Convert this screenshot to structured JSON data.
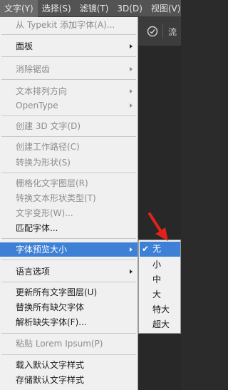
{
  "menubar": {
    "items": [
      "文字(Y)",
      "选择(S)",
      "滤镜(T)",
      "3D(D)",
      "视图(V)"
    ]
  },
  "toolbar": {
    "flow_text": "流"
  },
  "menu": {
    "items": [
      {
        "label": "从 Typekit 添加字体(A)...",
        "disabled": true
      },
      {
        "label": "面板",
        "disabled": false,
        "submenu": true
      },
      {
        "label": "消除锯齿",
        "disabled": true,
        "submenu": true
      },
      {
        "label": "文本排列方向",
        "disabled": true,
        "submenu": true
      },
      {
        "label": "OpenType",
        "disabled": true,
        "submenu": true
      },
      {
        "label": "创建 3D 文字(D)",
        "disabled": true
      },
      {
        "label": "创建工作路径(C)",
        "disabled": true
      },
      {
        "label": "转换为形状(S)",
        "disabled": true
      },
      {
        "label": "栅格化文字图层(R)",
        "disabled": true
      },
      {
        "label": "转换文本形状类型(T)",
        "disabled": true
      },
      {
        "label": "文字变形(W)...",
        "disabled": true
      },
      {
        "label": "匹配字体...",
        "disabled": false
      },
      {
        "label": "字体预览大小",
        "disabled": false,
        "submenu": true,
        "highlighted": true
      },
      {
        "label": "语言选项",
        "disabled": false,
        "submenu": true
      },
      {
        "label": "更新所有文字图层(U)",
        "disabled": false
      },
      {
        "label": "替换所有缺欠字体",
        "disabled": false
      },
      {
        "label": "解析缺失字体(F)...",
        "disabled": false
      },
      {
        "label": "粘贴 Lorem Ipsum(P)",
        "disabled": true
      },
      {
        "label": "载入默认文字样式",
        "disabled": false
      },
      {
        "label": "存储默认文字样式",
        "disabled": false
      }
    ]
  },
  "submenu": {
    "items": [
      {
        "label": "无",
        "checked": true
      },
      {
        "label": "小",
        "checked": false
      },
      {
        "label": "中",
        "checked": false
      },
      {
        "label": "大",
        "checked": false
      },
      {
        "label": "特大",
        "checked": false
      },
      {
        "label": "超大",
        "checked": false
      }
    ]
  },
  "colors": {
    "highlight": "#3d80d6",
    "annotation_arrow": "#e0221b"
  }
}
